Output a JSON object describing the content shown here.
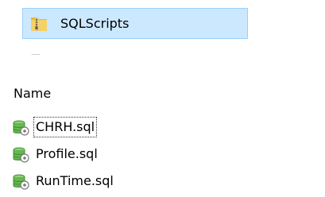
{
  "folder": {
    "label": "SQLScripts",
    "icon": "zip-folder-icon"
  },
  "partial_item": {
    "icon": "file-icon"
  },
  "file_list": {
    "column_header": "Name",
    "items": [
      {
        "label": "CHRH.sql",
        "icon": "sql-file-icon",
        "focused": true
      },
      {
        "label": "Profile.sql",
        "icon": "sql-file-icon",
        "focused": false
      },
      {
        "label": "RunTime.sql",
        "icon": "sql-file-icon",
        "focused": false
      }
    ]
  },
  "colors": {
    "selection_fill": "#cce8ff",
    "selection_border": "#99d1ff",
    "folder_yellow": "#f4c542",
    "sql_icon_green": "#5fb34a"
  }
}
